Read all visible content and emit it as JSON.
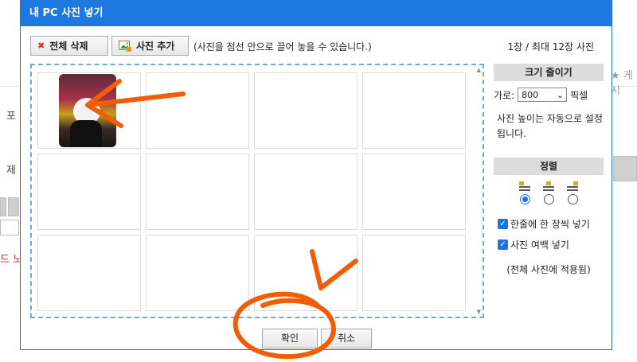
{
  "dialog": {
    "title": "내 PC 사진 넣기",
    "toolbar": {
      "delete_all_label": "전체 삭제",
      "add_photo_label": "사진 추가",
      "hint": "(사진을 점선 안으로 끌어 놓을 수 있습니다.)",
      "count": "1장 / 최대 12장 사진"
    },
    "grid": {
      "rows": 3,
      "cols": 4,
      "filled": 1
    },
    "resize": {
      "header": "크기 줄이기",
      "width_label": "가로:",
      "width_value": "800",
      "unit": "픽셀",
      "note": "사진 높이는 자동으로 설정됩니다."
    },
    "align": {
      "header": "정렬",
      "options": [
        "left",
        "center",
        "right"
      ],
      "selected": "left"
    },
    "options": {
      "one_per_line": "한줄에 한 장씩 넣기",
      "photo_margin": "사진 여백 넣기",
      "applies_all": "(전체 사진에 적용됨)"
    },
    "buttons": {
      "ok": "확인",
      "cancel": "취소"
    }
  },
  "background": {
    "left_fragments": [
      "포",
      "제",
      "드 노"
    ],
    "right_fragment": "★ 게시"
  },
  "colors": {
    "titlebar": "#1e78e0",
    "annotation": "#f25c05",
    "dropzone_border": "#6fa8dc"
  }
}
